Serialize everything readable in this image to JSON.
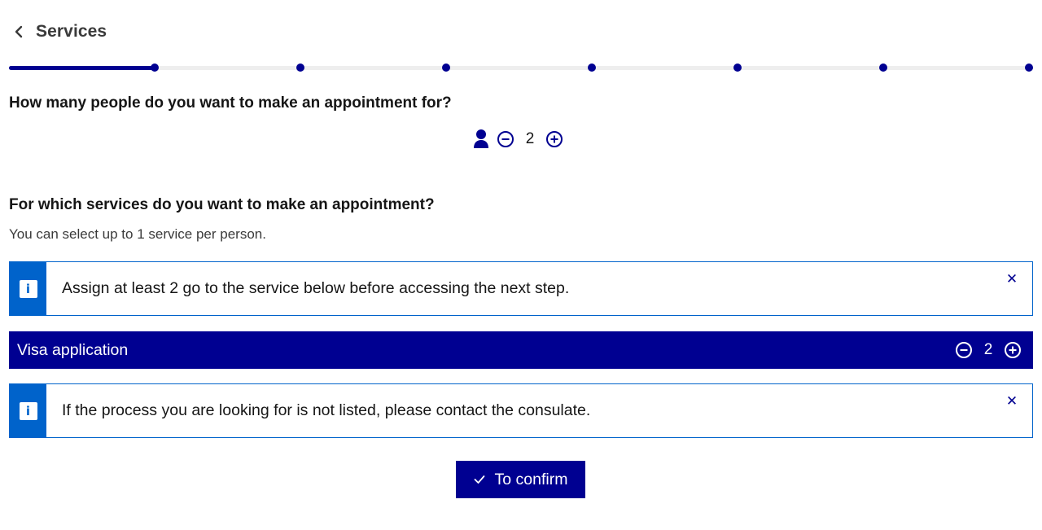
{
  "header": {
    "title": "Services",
    "back_icon": "chevron-left-icon"
  },
  "progress": {
    "total_steps": 8,
    "current_step": 2,
    "accent": "#000091",
    "track": "#eeeeee"
  },
  "people": {
    "question": "How many people do you want to make an appointment for?",
    "count": "2",
    "person_icon": "person-icon",
    "decrement_icon": "minus-circle-icon",
    "increment_icon": "plus-circle-icon"
  },
  "services": {
    "question": "For which services do you want to make an appointment?",
    "hint": "You can select up to 1 service per person.",
    "alerts": [
      {
        "text": "Assign at least 2 go to the service below before accessing the next step.",
        "icon": "info-icon",
        "close_icon": "close-icon",
        "close_glyph": "✕"
      },
      {
        "text": "If the process you are looking for is not listed, please contact the consulate.",
        "icon": "info-icon",
        "close_icon": "close-icon",
        "close_glyph": "✕"
      }
    ],
    "items": [
      {
        "label": "Visa application",
        "count": "2"
      }
    ]
  },
  "confirm": {
    "label": "To confirm",
    "icon": "check-icon"
  },
  "colors": {
    "primary": "#000091",
    "info": "#0063cb",
    "text": "#161616",
    "muted": "#3a3a3a"
  }
}
